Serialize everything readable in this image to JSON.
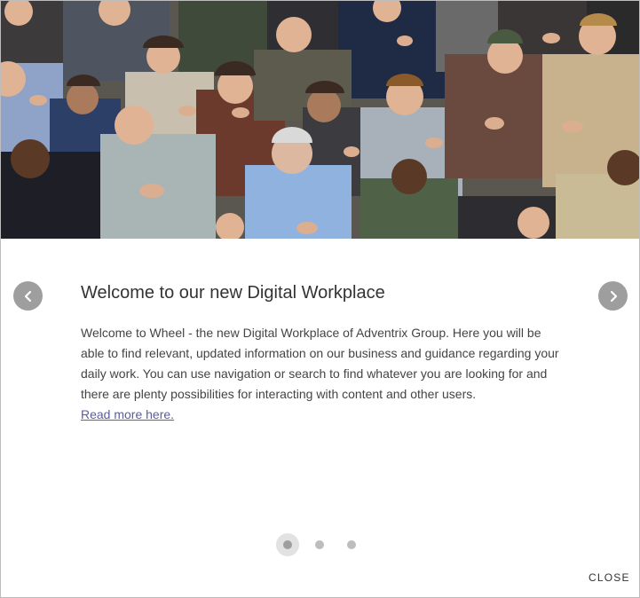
{
  "dialog": {
    "title": "Welcome to our new Digital Workplace",
    "body": "Welcome to Wheel - the new Digital Workplace of Adventrix Group. Here you will be able to find relevant, updated information on our business and guidance regarding your daily work. You can use navigation or search to find whatever you are looking for and there are plenty possibilities for interacting with content and other users.",
    "read_more_label": "Read more here.",
    "close_label": "CLOSE"
  },
  "hero": {
    "image_icon": "crowd-applauding-photo"
  },
  "navigation": {
    "prev_icon": "chevron-left-icon",
    "next_icon": "chevron-right-icon"
  },
  "pager": {
    "total": 3,
    "active_index": 0
  },
  "colors": {
    "arrow_bg": "#9e9e9e",
    "link": "#5c5c9e",
    "dot_active": "#9e9e9e",
    "dot_inactive": "#bdbdbd"
  }
}
